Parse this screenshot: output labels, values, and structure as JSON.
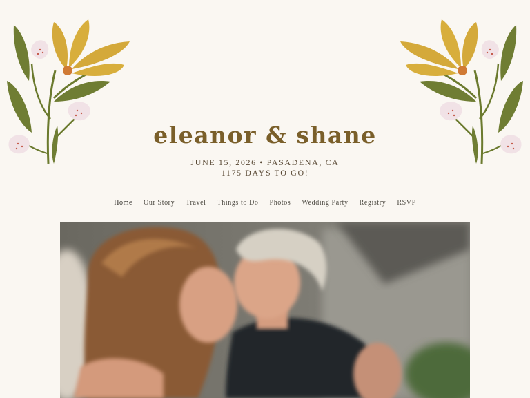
{
  "couple": {
    "names": "eleanor & shane"
  },
  "event": {
    "date_location": "JUNE 15, 2026 • PASADENA, CA",
    "countdown": "1175 DAYS TO GO!"
  },
  "nav": {
    "items": [
      {
        "label": "Home",
        "active": true
      },
      {
        "label": "Our Story"
      },
      {
        "label": "Travel"
      },
      {
        "label": "Things to Do"
      },
      {
        "label": "Photos"
      },
      {
        "label": "Wedding Party"
      },
      {
        "label": "Registry"
      },
      {
        "label": "RSVP"
      }
    ]
  },
  "colors": {
    "background": "#faf7f2",
    "title": "#7a5f2a",
    "accent_gold": "#d4a93a",
    "leaf_green": "#6b7a2e",
    "blossom_pink": "#f1e2e6"
  },
  "decor": {
    "left_floral": "floral-illustration",
    "right_floral": "floral-illustration"
  },
  "hero": {
    "image": "couple-kissing-photo"
  }
}
